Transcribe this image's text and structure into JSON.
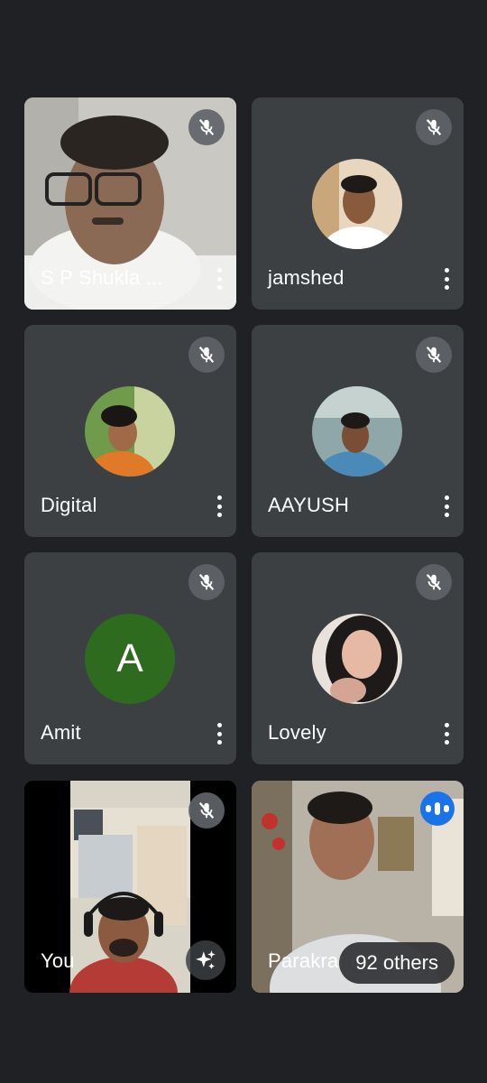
{
  "participants": [
    {
      "name": "S P Shukla ...",
      "muted": true,
      "type": "video"
    },
    {
      "name": "jamshed",
      "muted": true,
      "type": "photo"
    },
    {
      "name": "Digital",
      "muted": true,
      "type": "photo"
    },
    {
      "name": "AAYUSH",
      "muted": true,
      "type": "photo"
    },
    {
      "name": "Amit",
      "muted": true,
      "type": "letter",
      "initial": "A",
      "avatar_color": "#2e6b1f"
    },
    {
      "name": "Lovely",
      "muted": true,
      "type": "photo"
    },
    {
      "name": "You",
      "muted": true,
      "type": "video"
    },
    {
      "name": "Parakram",
      "muted": false,
      "type": "video",
      "speaking": true
    }
  ],
  "overflow": {
    "label": "92 others"
  },
  "colors": {
    "background": "#202124",
    "tile": "#3c4043",
    "speaking_indicator": "#1a73e8"
  }
}
